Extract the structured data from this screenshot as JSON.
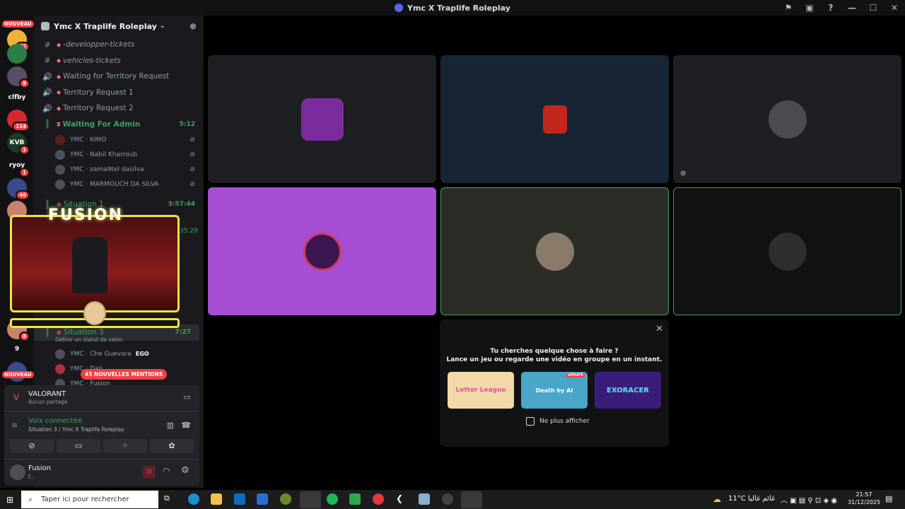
{
  "window": {
    "title": "Ymc X Traplife Roleplay",
    "controls": [
      "⚑",
      "▣",
      "?",
      "—",
      "☐",
      "✕"
    ]
  },
  "rail": {
    "nouveau_label": "NOUVEAU",
    "badges": [
      "52",
      "8",
      "114",
      "1",
      "1",
      "46",
      "6"
    ],
    "texts": [
      "clfby",
      "KVB",
      "ryoy",
      "9"
    ]
  },
  "server_name": "Ymc X Traplife Roleplay",
  "channels": [
    {
      "label": "-developper-tickets",
      "type": "text",
      "italic": true
    },
    {
      "label": "vehicles-tickets",
      "type": "text",
      "italic": true
    },
    {
      "label": "Waiting for Territory Request",
      "type": "voice"
    },
    {
      "label": "Territory Request 1",
      "type": "voice"
    },
    {
      "label": "Territory Request 2",
      "type": "voice"
    }
  ],
  "waiting_admin": {
    "label": "Waiting For Admin",
    "time": "5:12"
  },
  "members": [
    "YMC · KIMO",
    "YMC · Nabil Kharroub",
    "YMC · zama9tel dasilva",
    "YMC · MARMOUCH DA SILVA"
  ],
  "situation1": {
    "label": "Situation 1",
    "time": "3:57:44"
  },
  "situation1_time2": "35:28",
  "situation3": {
    "label": "Situation 3",
    "time": "7:27",
    "status_hint": "Définir un statut de salon"
  },
  "situation3_members": [
    "YMC · Che Guevara",
    "YMC · Dali",
    "YMC · Fusion"
  ],
  "ego_tag": "EGO",
  "mentions_pill": "45 NOUVELLES MENTIONS",
  "overlay_title": "FUSION",
  "activity_panel": {
    "game": "VALORANT",
    "sub": "Aucun partage"
  },
  "voice": {
    "status": "Voix connectée",
    "channel": "Situation 3 / Ymc X Traplife Roleplay"
  },
  "user": {
    "name": "Fusion",
    "status": "f..."
  },
  "popup": {
    "line1": "Tu cherches quelque chose à faire ?",
    "line2": "Lance un jeu ou regarde une vidéo en groupe en un instant.",
    "games": [
      "Letter League",
      "Death by AI",
      "EXORACER"
    ],
    "update_tag": "UPDATE",
    "checkbox_label": "Ne plus afficher"
  },
  "taskbar": {
    "search_placeholder": "Taper ici pour rechercher",
    "weather": "11°C  غائم غالبا",
    "time": "21:57",
    "date": "31/12/2025"
  }
}
